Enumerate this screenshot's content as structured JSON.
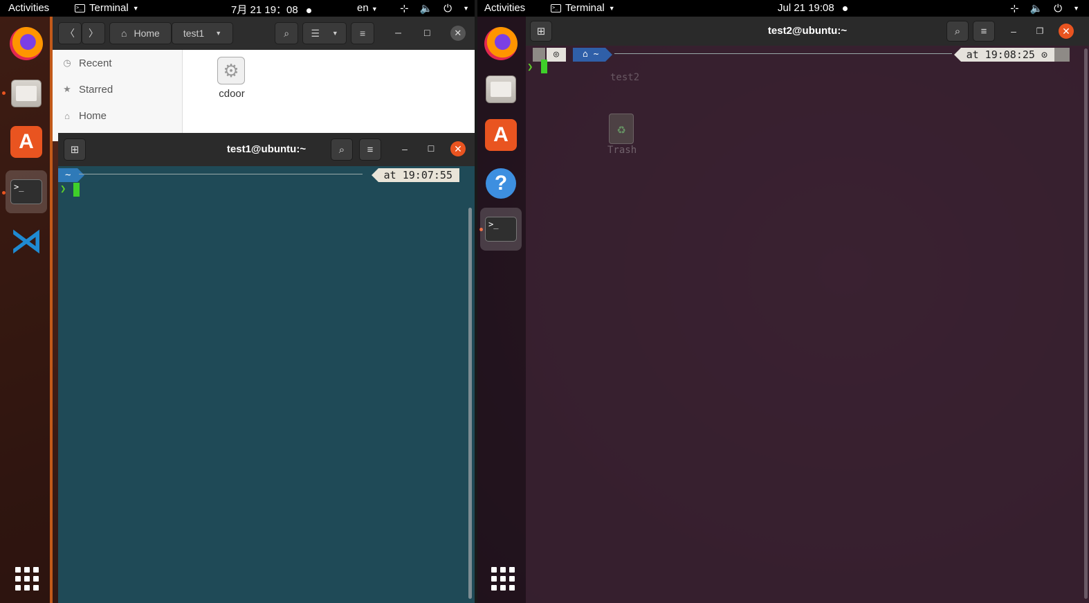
{
  "left": {
    "topbar": {
      "activities": "Activities",
      "app_name": "Terminal",
      "clock": "7月 21  19：08",
      "lang": "en"
    },
    "files": {
      "breadcrumb_home": "Home",
      "breadcrumb_current": "test1",
      "sidebar": [
        {
          "label": "Recent",
          "icon": "clock-icon"
        },
        {
          "label": "Starred",
          "icon": "star-icon"
        },
        {
          "label": "Home",
          "icon": "home-icon"
        }
      ],
      "file_name": "cdoor"
    },
    "terminal": {
      "title": "test1@ubuntu:~",
      "dir": "~",
      "time": "at 19:07:55"
    }
  },
  "right": {
    "topbar": {
      "activities": "Activities",
      "app_name": "Terminal",
      "clock": "Jul 21  19:08"
    },
    "terminal": {
      "title": "test2@ubuntu:~",
      "dir": "~",
      "time": "at 19:08:25 ⊙"
    },
    "desktop": {
      "trash_label": "Trash",
      "ghost_label": "test2"
    }
  },
  "colors": {
    "accent": "#e95420",
    "cursor": "#3fcf2a",
    "term1_bg": "#1f4a57"
  }
}
